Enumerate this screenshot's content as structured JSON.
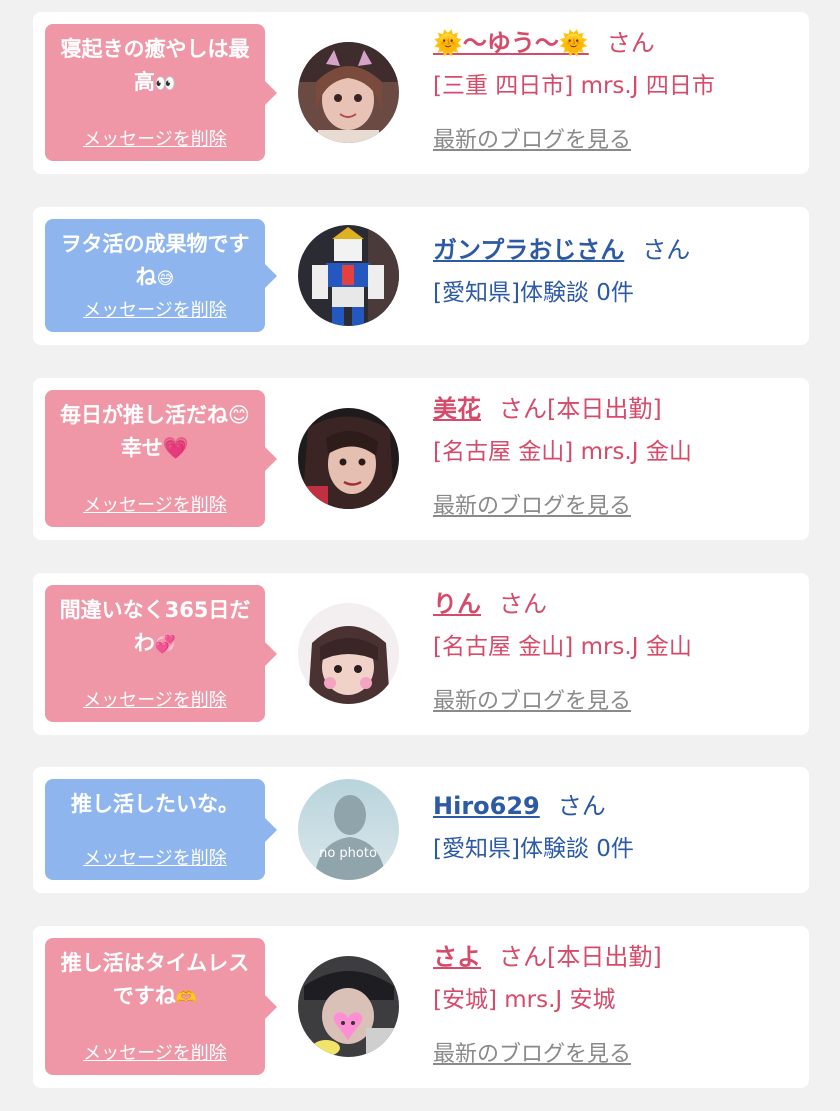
{
  "delete_label": "メッセージを削除",
  "blog_label": "最新のブログを見る",
  "san": "さん",
  "cards": [
    {
      "bubble_color": "#ef97a7",
      "message": "寝起きの癒やしは最高",
      "message_emoji": "eyes-emoji",
      "name": "🌞〜ゆう〜🌞",
      "name_suffix": "",
      "location": "[三重 四日市] mrs.J 四日市",
      "has_blog": true,
      "avatar": "woman-with-cat-filter"
    },
    {
      "bubble_color": "#8eb5ee",
      "message": "ヲタ活の成果物ですね",
      "message_emoji": "sweat-smile-emoji",
      "name": "ガンプラおじさん",
      "name_suffix": "",
      "location": "[愛知県]体験談 0件",
      "has_blog": false,
      "avatar": "gundam-model"
    },
    {
      "bubble_color": "#ef97a7",
      "message": "毎日が推し活だね😊幸せ💗",
      "message_emoji": "",
      "name": "美花",
      "name_suffix": "[本日出勤]",
      "location": "[名古屋 金山] mrs.J 金山",
      "has_blog": true,
      "avatar": "woman-dark-hair"
    },
    {
      "bubble_color": "#ef97a7",
      "message": "間違いなく365日だわ",
      "message_emoji": "hearts-emoji",
      "name": "りん",
      "name_suffix": "",
      "location": "[名古屋 金山] mrs.J 金山",
      "has_blog": true,
      "avatar": "woman-bangs-stickers"
    },
    {
      "bubble_color": "#8eb5ee",
      "message": "推し活したいな。",
      "message_emoji": "",
      "name": "Hiro629",
      "name_suffix": "",
      "location": "[愛知県]体験談 0件",
      "has_blog": false,
      "avatar": "no-photo",
      "avatar_text": "no photo"
    },
    {
      "bubble_color": "#ef97a7",
      "message": "推し活はタイムレスですね",
      "message_emoji": "heart-hands-emoji",
      "name": "さよ",
      "name_suffix": "[本日出勤]",
      "location": "[安城] mrs.J 安城",
      "has_blog": true,
      "avatar": "person-heart-sticker"
    }
  ]
}
